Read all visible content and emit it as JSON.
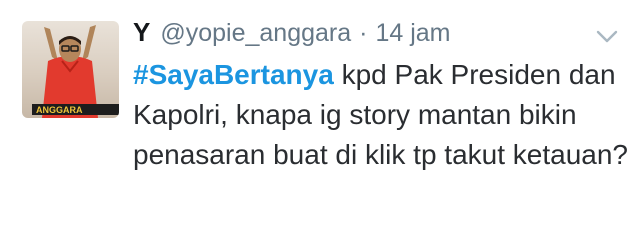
{
  "tweet": {
    "author": {
      "display_name": "Y",
      "handle": "@yopie_anggara",
      "avatar_watermark": "ANGGARA"
    },
    "separator": "·",
    "timestamp": "14 jam",
    "hashtag": "#SayaBertanya",
    "body": " kpd Pak Presiden dan Kapolri, knapa ig story mantan bikin penasaran buat di klik tp takut ketauan?",
    "menu_icon": "chevron-down-icon"
  },
  "colors": {
    "hashtag": "#1b95e0",
    "secondary_text": "#657786",
    "primary_text": "#14171a"
  }
}
